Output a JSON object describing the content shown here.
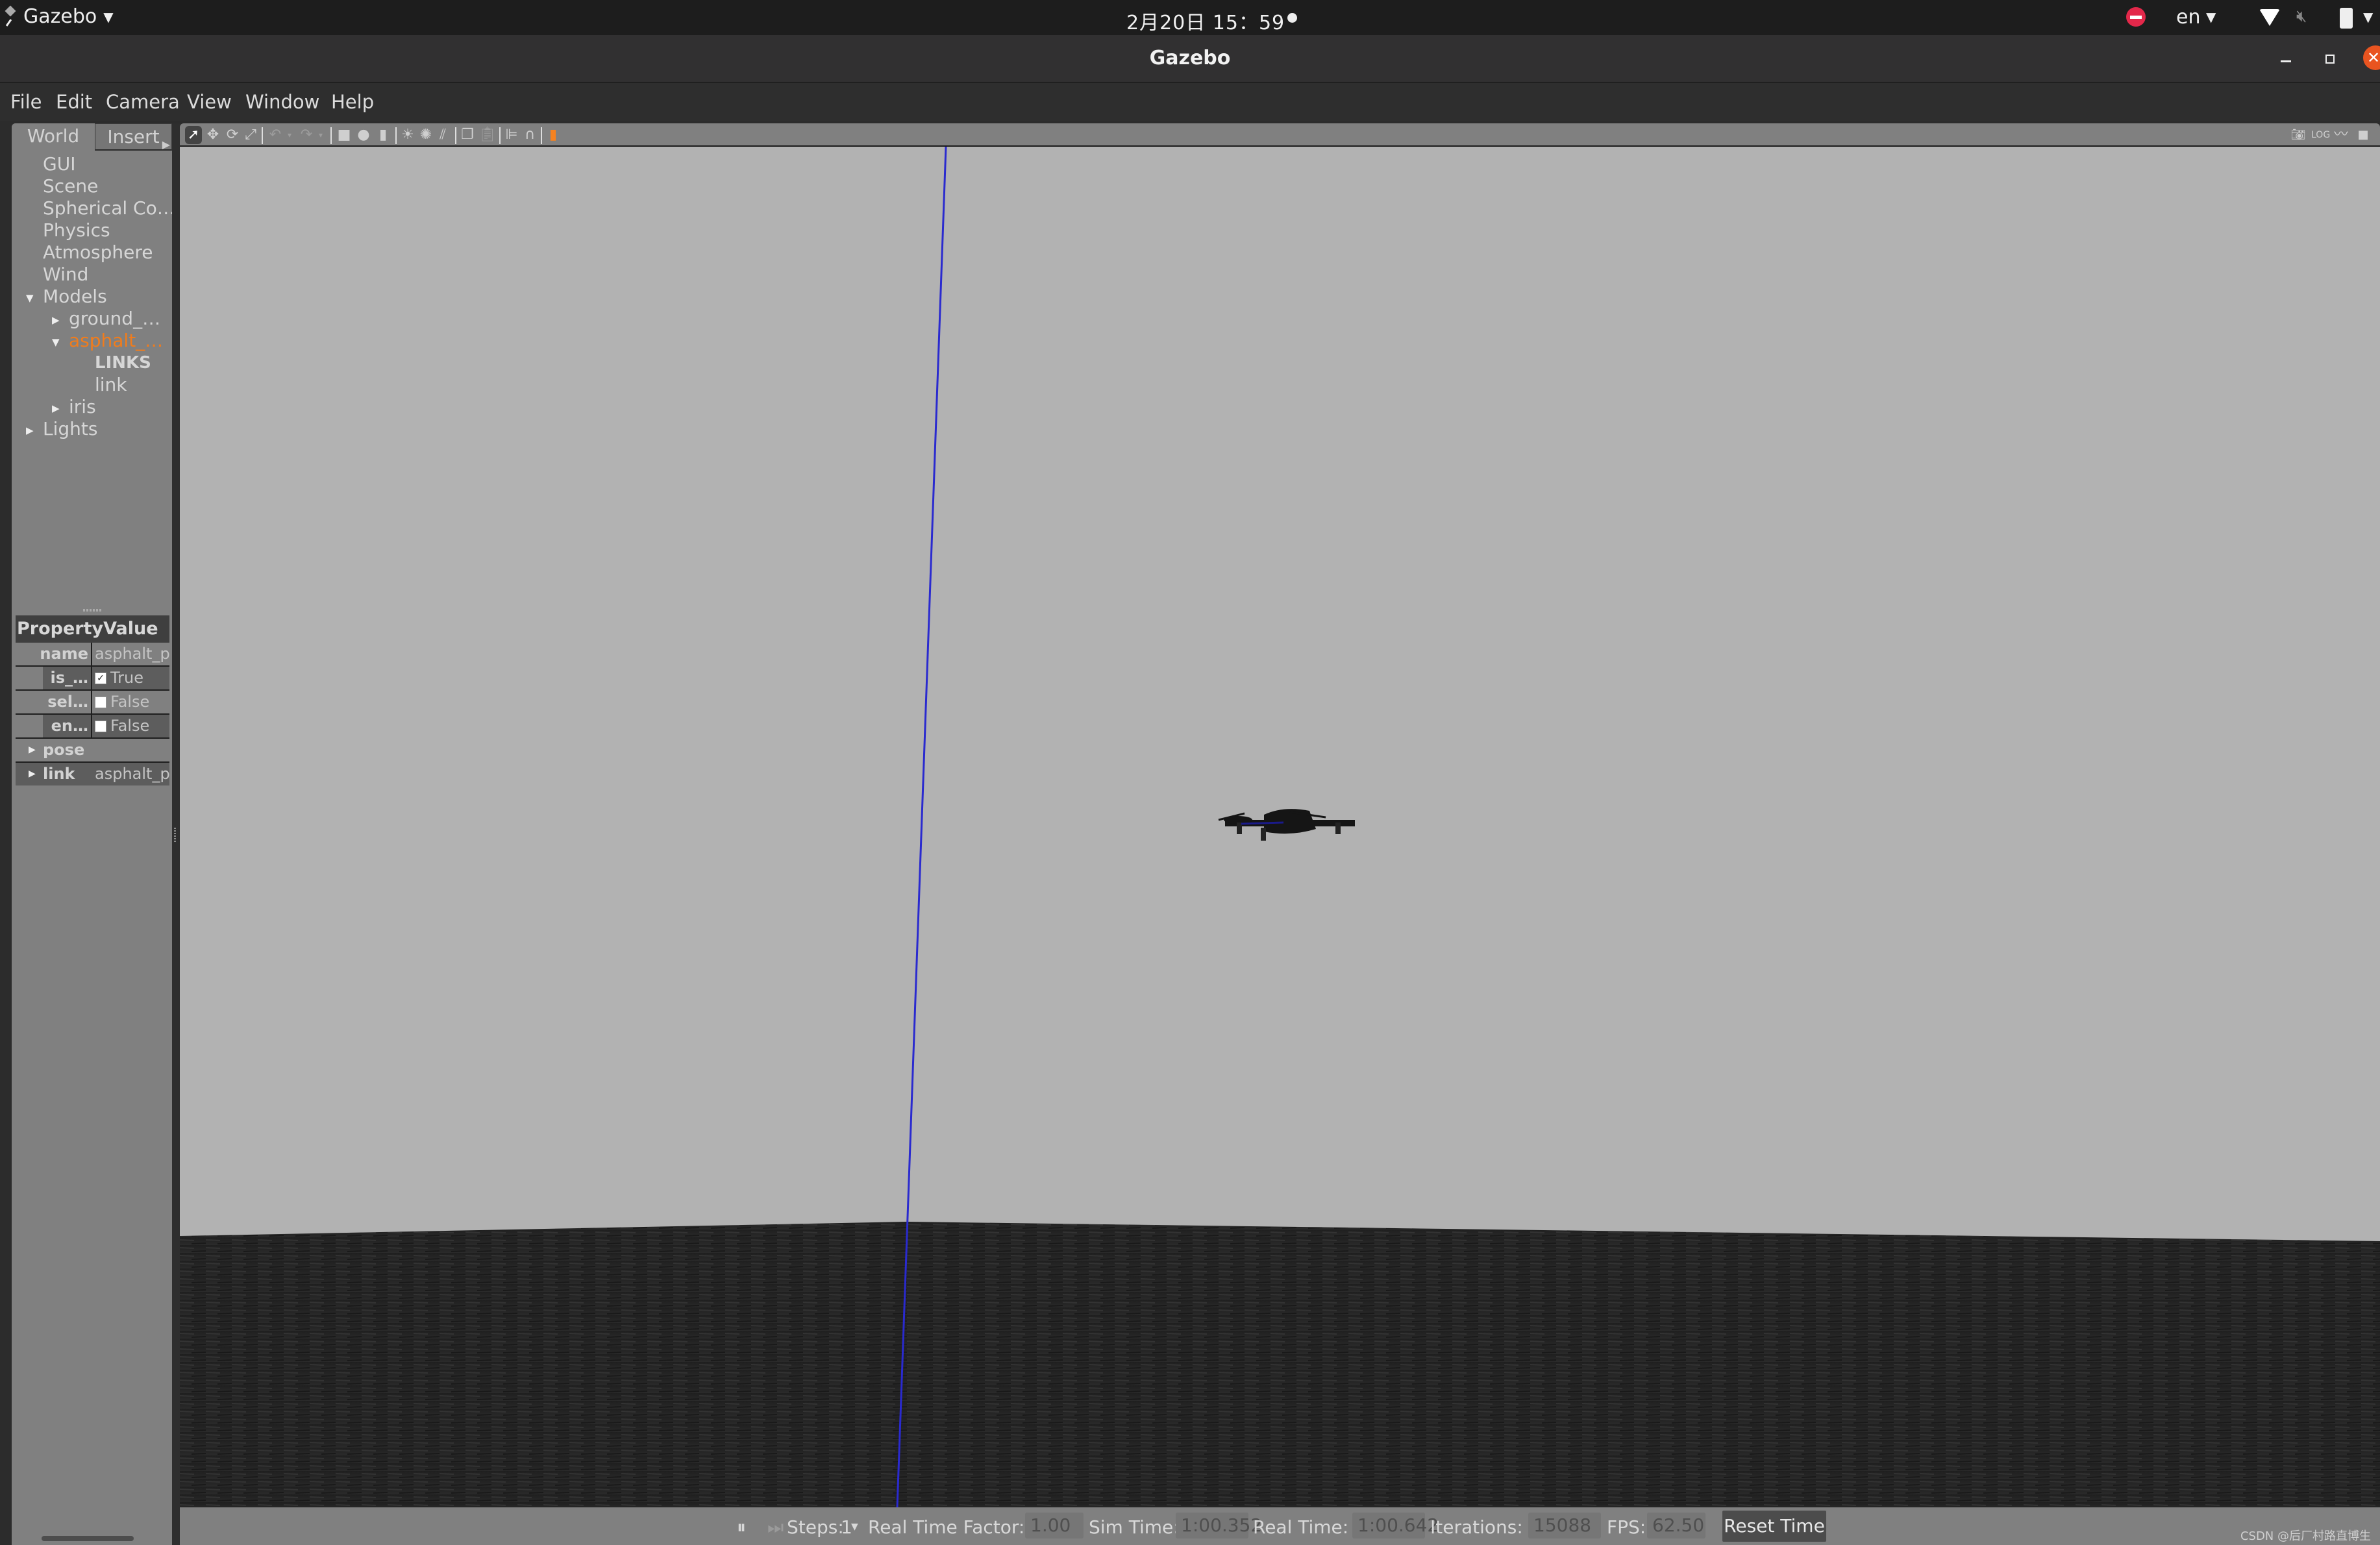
{
  "topbar": {
    "app_name": "Gazebo",
    "clock": "2月20日  15：59",
    "language": "en"
  },
  "window": {
    "title": "Gazebo",
    "close_glyph": "✕"
  },
  "menu": [
    "File",
    "Edit",
    "Camera",
    "View",
    "Window",
    "Help"
  ],
  "left_panel": {
    "tabs": [
      "World",
      "Insert"
    ],
    "tree": [
      {
        "label": "GUI"
      },
      {
        "label": "Scene"
      },
      {
        "label": "Spherical Co…"
      },
      {
        "label": "Physics"
      },
      {
        "label": "Atmosphere"
      },
      {
        "label": "Wind"
      },
      {
        "label": "Models",
        "expanded": true
      },
      {
        "label": "ground_…",
        "expanded": false
      },
      {
        "label": "asphalt_…",
        "expanded": true,
        "selected": true
      },
      {
        "label": "LINKS"
      },
      {
        "label": "link"
      },
      {
        "label": "iris",
        "expanded": false
      },
      {
        "label": "Lights",
        "expanded": false
      }
    ],
    "properties": {
      "header": "PropertyValue",
      "rows": [
        {
          "key": "name",
          "value": "asphalt_p"
        },
        {
          "key": "is_…",
          "value": "True",
          "checked": true
        },
        {
          "key": "sel…",
          "value": "False",
          "checked": false
        },
        {
          "key": "en…",
          "value": "False",
          "checked": false
        }
      ],
      "groups": [
        {
          "key": "pose",
          "value": ""
        },
        {
          "key": "link",
          "value": "asphalt_p"
        }
      ]
    }
  },
  "toolbar": {
    "left_icons": [
      "select-mode",
      "translate-mode",
      "rotate-mode",
      "scale-mode",
      "undo",
      "undo-history",
      "redo",
      "redo-history",
      "box",
      "sphere",
      "cylinder",
      "point-light",
      "spot-light",
      "directional-light",
      "copy",
      "paste",
      "align",
      "snap",
      "view-angle"
    ],
    "right_icons": [
      "screenshot",
      "log",
      "plot",
      "video-record"
    ]
  },
  "status": {
    "steps_label": "Steps:",
    "steps_value": "1",
    "rtf_label": "Real Time Factor:",
    "rtf_value": "1.00",
    "sim_time_label": "Sim Time:",
    "sim_time_value": "1:00.352",
    "real_time_label": "Real Time:",
    "real_time_value": "1:00.642",
    "iterations_label": "Iterations:",
    "iterations_value": "15088",
    "fps_label": "FPS:",
    "fps_value": "62.50",
    "reset_label": "Reset Time",
    "watermark": "CSDN @后厂村路直博生"
  },
  "colors": {
    "accent_selected": "#f07c1c",
    "sky": "#b2b2b2",
    "ground": "#1f1f1f",
    "axis_z": "#2a2acf",
    "close_button": "#e95420",
    "dnd": "#e3284a"
  }
}
